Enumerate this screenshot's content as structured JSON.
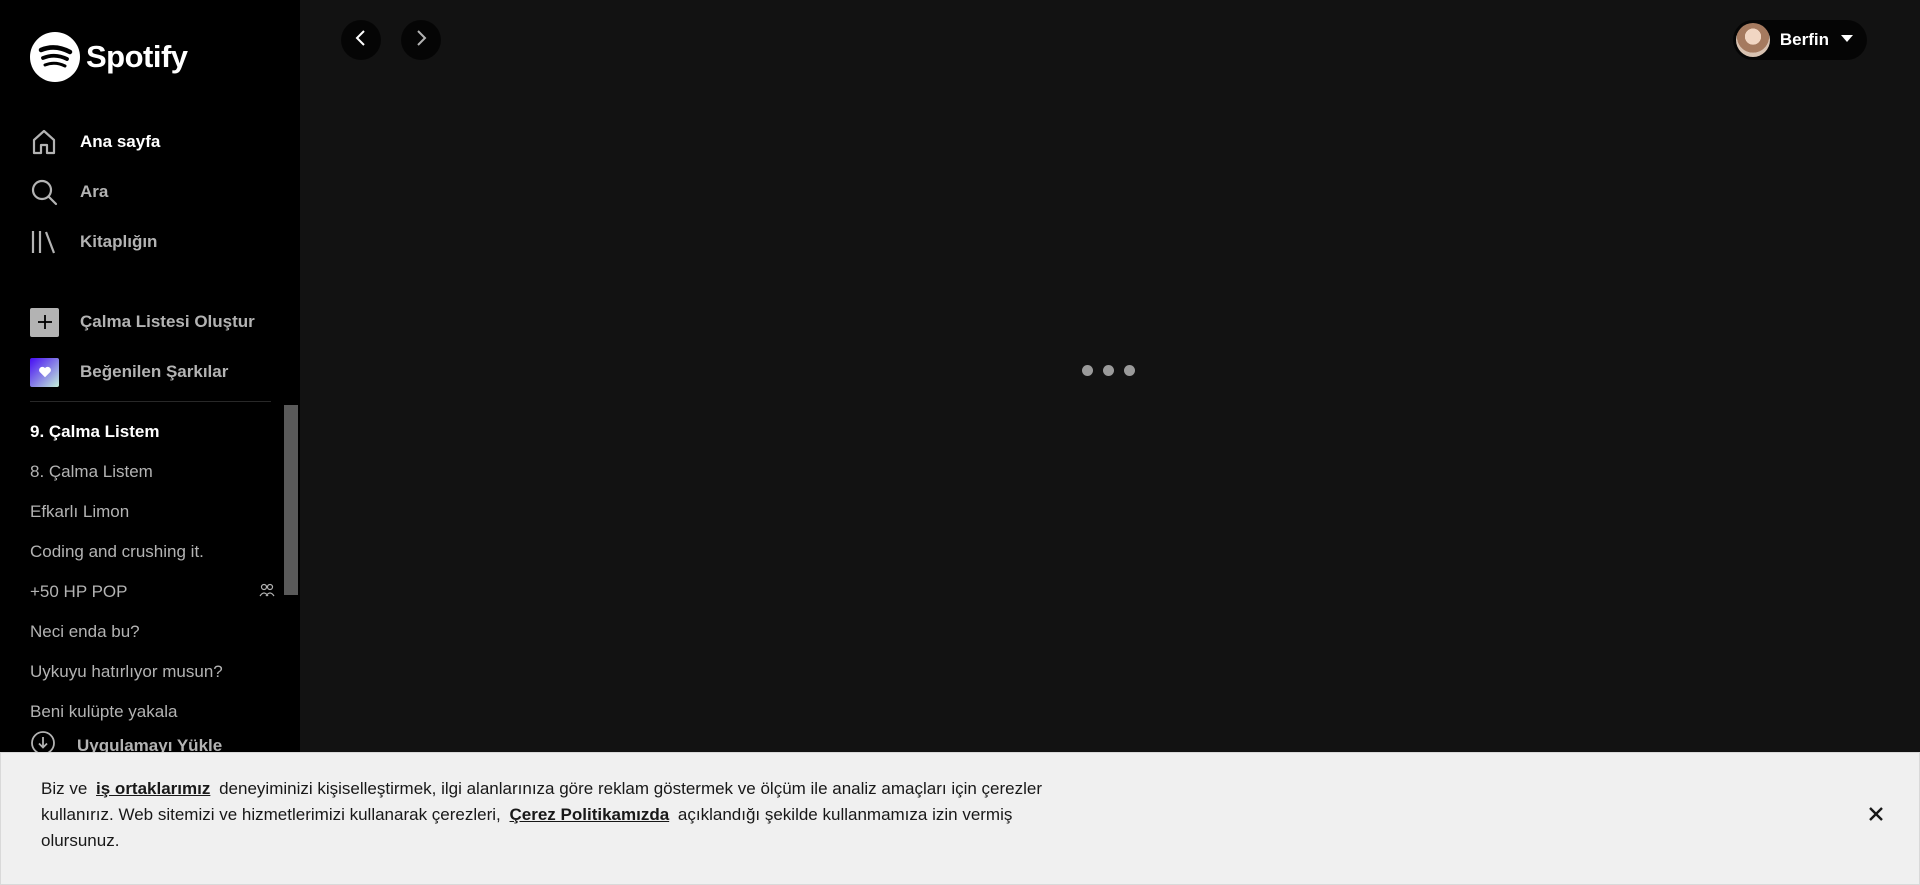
{
  "app": {
    "logo_text": "Spotify"
  },
  "sidebar": {
    "nav": [
      {
        "label": "Ana sayfa",
        "icon": "home-icon"
      },
      {
        "label": "Ara",
        "icon": "search-icon"
      },
      {
        "label": "Kitaplığın",
        "icon": "library-icon"
      }
    ],
    "actions": [
      {
        "label": "Çalma Listesi Oluştur",
        "icon": "plus-icon"
      },
      {
        "label": "Beğenilen Şarkılar",
        "icon": "heart-icon"
      }
    ],
    "playlists": [
      {
        "label": "9. Çalma Listem"
      },
      {
        "label": "8. Çalma Listem"
      },
      {
        "label": "Efkarlı Limon"
      },
      {
        "label": "Coding and crushing it."
      },
      {
        "label": "+50 HP POP",
        "icon": "collaborative-icon"
      },
      {
        "label": "Neci enda bu?"
      },
      {
        "label": "Uykuyu hatırlıyor musun?"
      },
      {
        "label": "Beni kulüpte yakala"
      }
    ],
    "install_label": "Uygulamayı Yükle"
  },
  "topbar": {
    "back_icon": "chevron-left-icon",
    "forward_icon": "chevron-right-icon",
    "user_name": "Berfin",
    "user_menu_icon": "caret-down-icon"
  },
  "cookie": {
    "text_1": "Biz ve",
    "link_1": "iş ortaklarımız",
    "text_2": "deneyiminizi kişiselleştirmek, ilgi alanlarınıza göre reklam göstermek ve ölçüm ile analiz amaçları için çerezler kullanırız. Web sitemizi ve hizmetlerimizi kullanarak çerezleri,",
    "link_2": "Çerez Politikamızda",
    "text_3": "açıklandığı şekilde kullanmamıza izin vermiş olursunuz.",
    "close_icon": "close-icon"
  },
  "colors": {
    "sidebar_bg": "#000000",
    "main_bg": "#121212",
    "text_muted": "#b3b3b3",
    "banner_bg": "#f0f0f0"
  }
}
